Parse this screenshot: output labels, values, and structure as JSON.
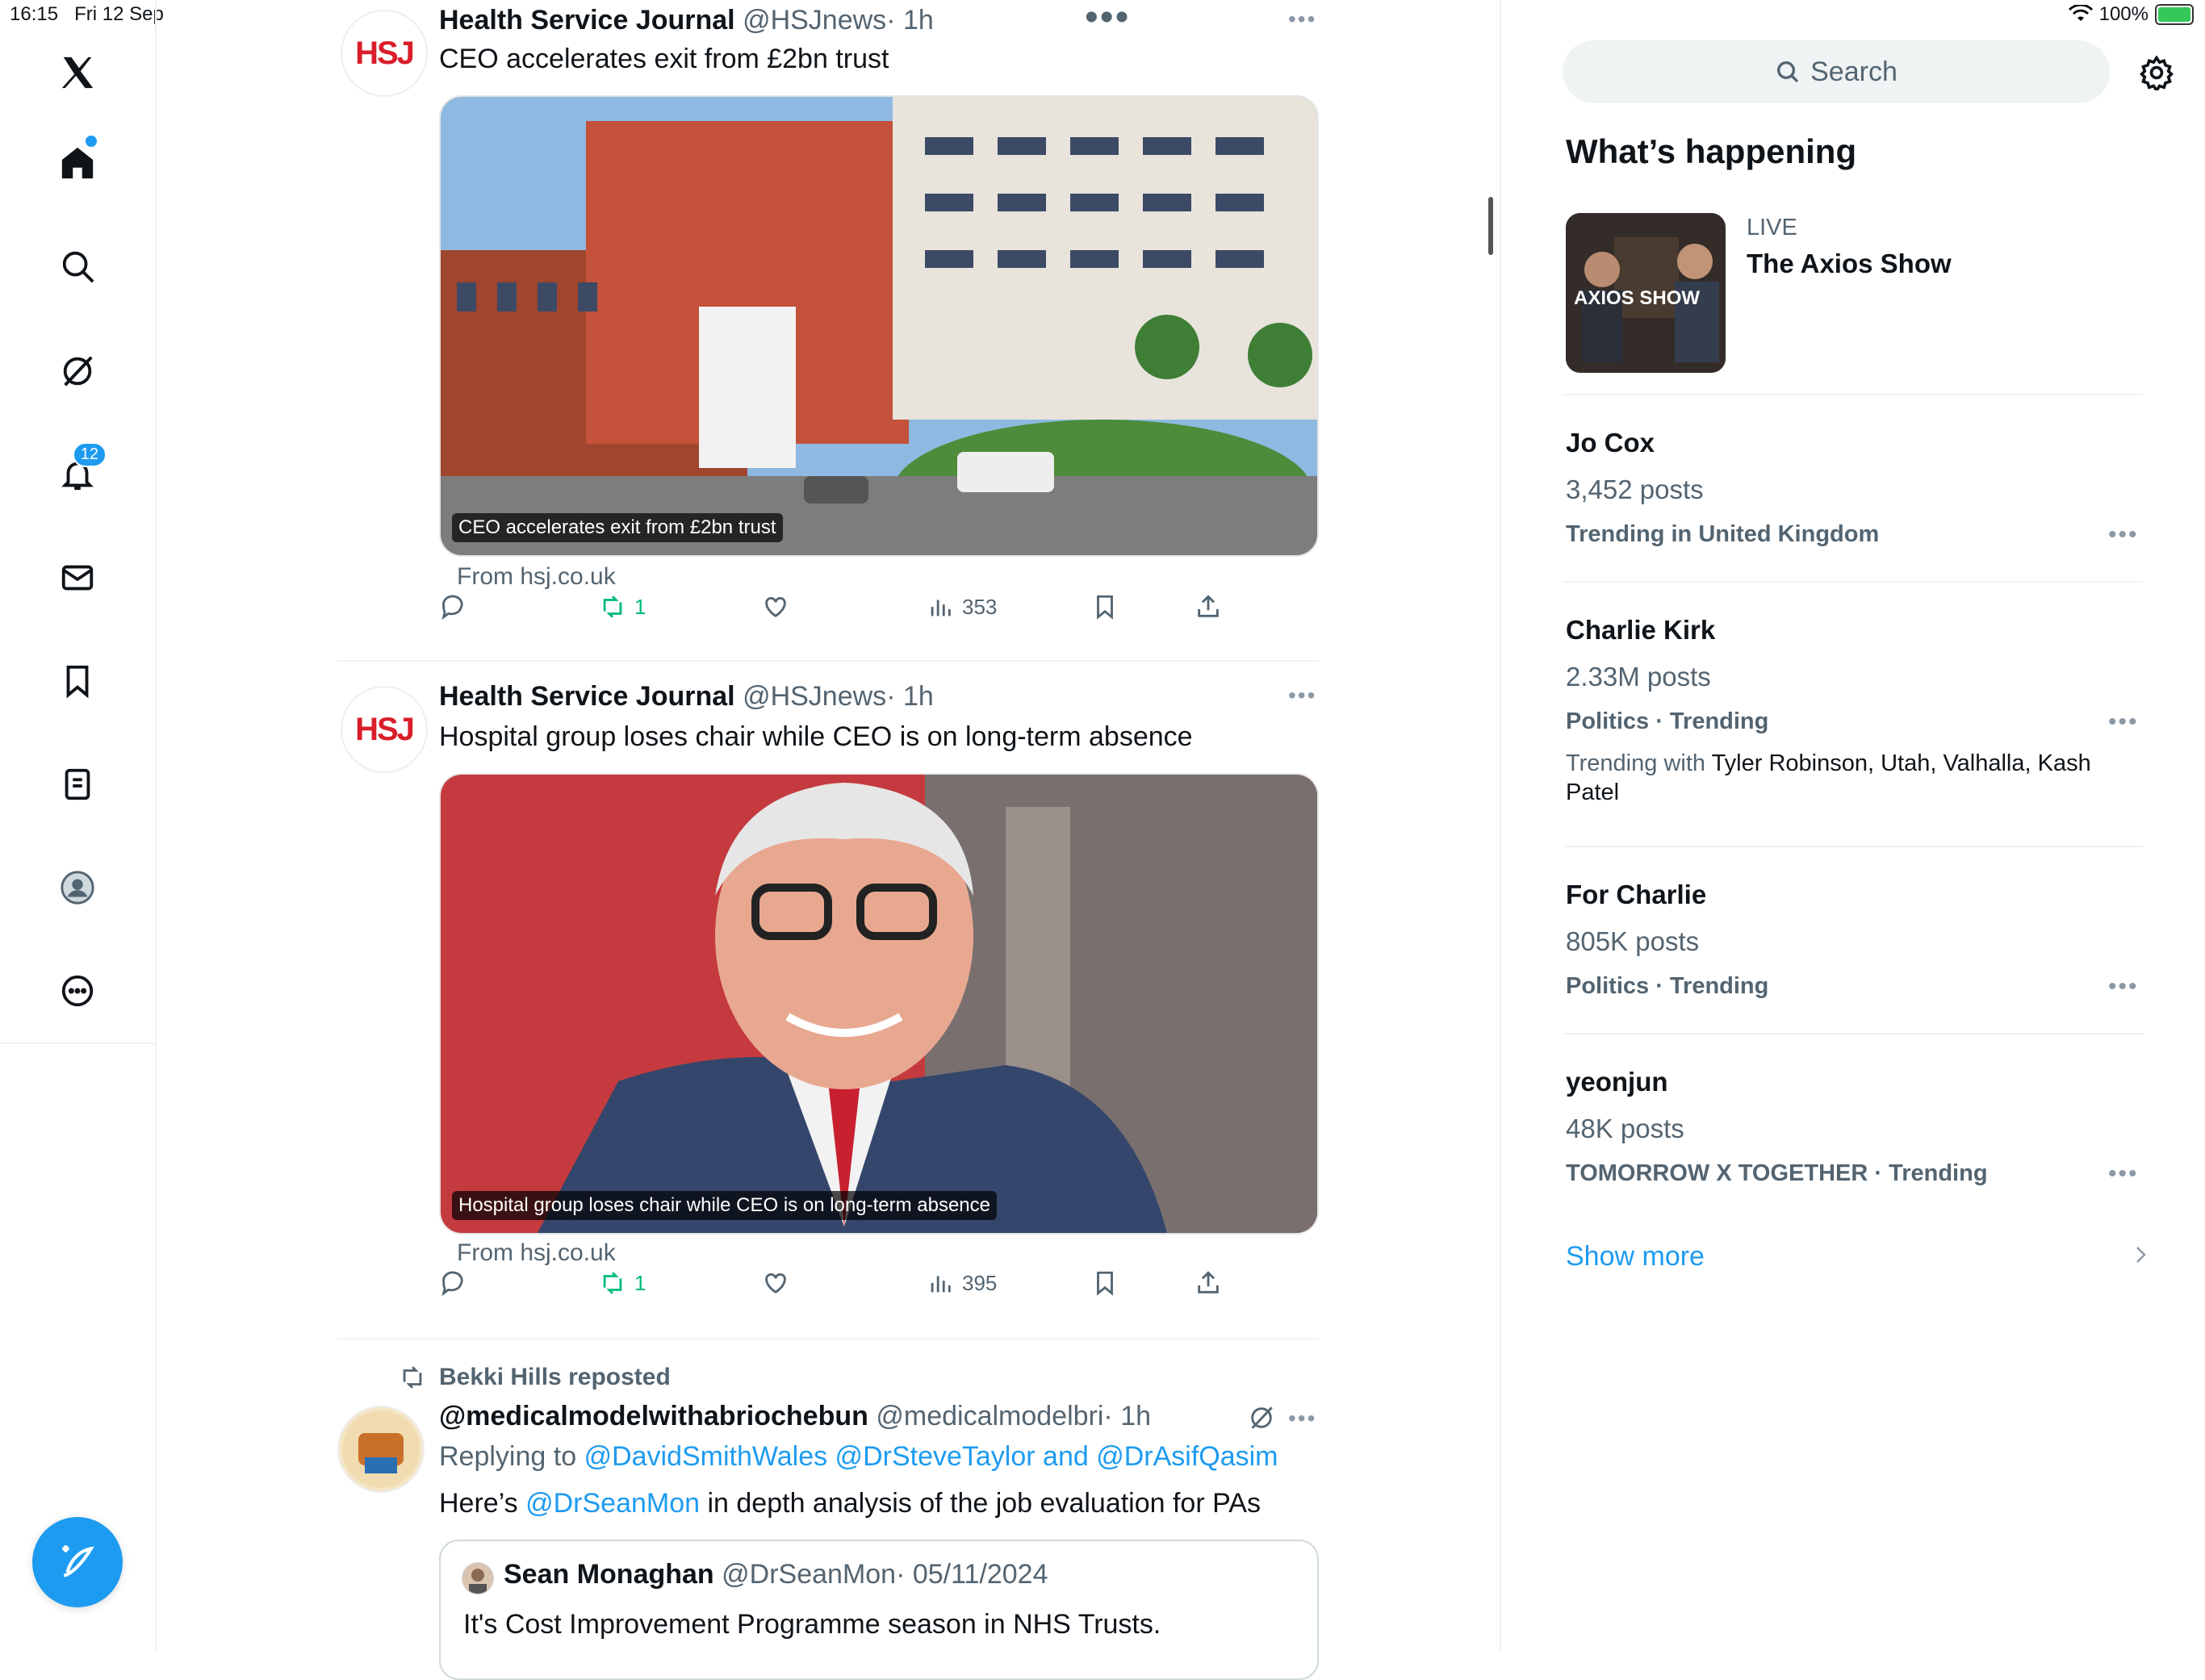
{
  "status": {
    "time": "16:15",
    "date": "Fri 12 Sep",
    "battery": "100%"
  },
  "nav": {
    "notifications_badge": "12"
  },
  "tweets": [
    {
      "author": "Health Service Journal",
      "handle": "@HSJnews",
      "time": "· 1h",
      "text": "CEO accelerates exit from £2bn trust",
      "caption": "CEO accelerates exit from £2bn trust",
      "from": "From hsj.co.uk",
      "retweets": "1",
      "views": "353"
    },
    {
      "author": "Health Service Journal",
      "handle": "@HSJnews",
      "time": "· 1h",
      "text": "Hospital group loses chair while CEO is on long-term absence",
      "caption": "Hospital group loses chair while CEO is on long-term absence",
      "from": "From hsj.co.uk",
      "retweets": "1",
      "views": "395"
    }
  ],
  "repost": {
    "label": "Bekki Hills reposted",
    "author": "@medicalmodelwithabriochebun",
    "handle": "@medicalmodelbri",
    "time": "· 1h",
    "replying_prefix": "Replying to",
    "replying_names": "@DavidSmithWales @DrSteveTaylor and @DrAsifQasim",
    "text_pre": "Here’s",
    "text_mention": "@DrSeanMon",
    "text_post": "in depth analysis of the job evaluation for PAs",
    "quote": {
      "author": "Sean Monaghan",
      "handle": "@DrSeanMon",
      "date": "· 05/11/2024",
      "text": "It's Cost Improvement Programme season in NHS Trusts."
    }
  },
  "right": {
    "search_placeholder": "Search",
    "section_title": "What’s happening",
    "live": {
      "label": "LIVE",
      "title": "The Axios Show",
      "thumb_text": "AXIOS SHOW"
    },
    "trends": [
      {
        "name": "Jo Cox",
        "count": "3,452 posts",
        "meta": "Trending in United Kingdom"
      },
      {
        "name": "Charlie Kirk",
        "count": "2.33M posts",
        "meta": "Politics · Trending",
        "with_prefix": "Trending with",
        "with": "Tyler Robinson, Utah, Valhalla, Kash Patel"
      },
      {
        "name": "For Charlie",
        "count": "805K posts",
        "meta": "Politics · Trending"
      },
      {
        "name": "yeonjun",
        "count": "48K posts",
        "meta": "TOMORROW X TOGETHER · Trending"
      }
    ],
    "show_more": "Show more"
  },
  "colors": {
    "accent": "#1d9bf0",
    "retweet_green": "#00ba7c",
    "text": "#0f1419",
    "muted": "#536471"
  }
}
